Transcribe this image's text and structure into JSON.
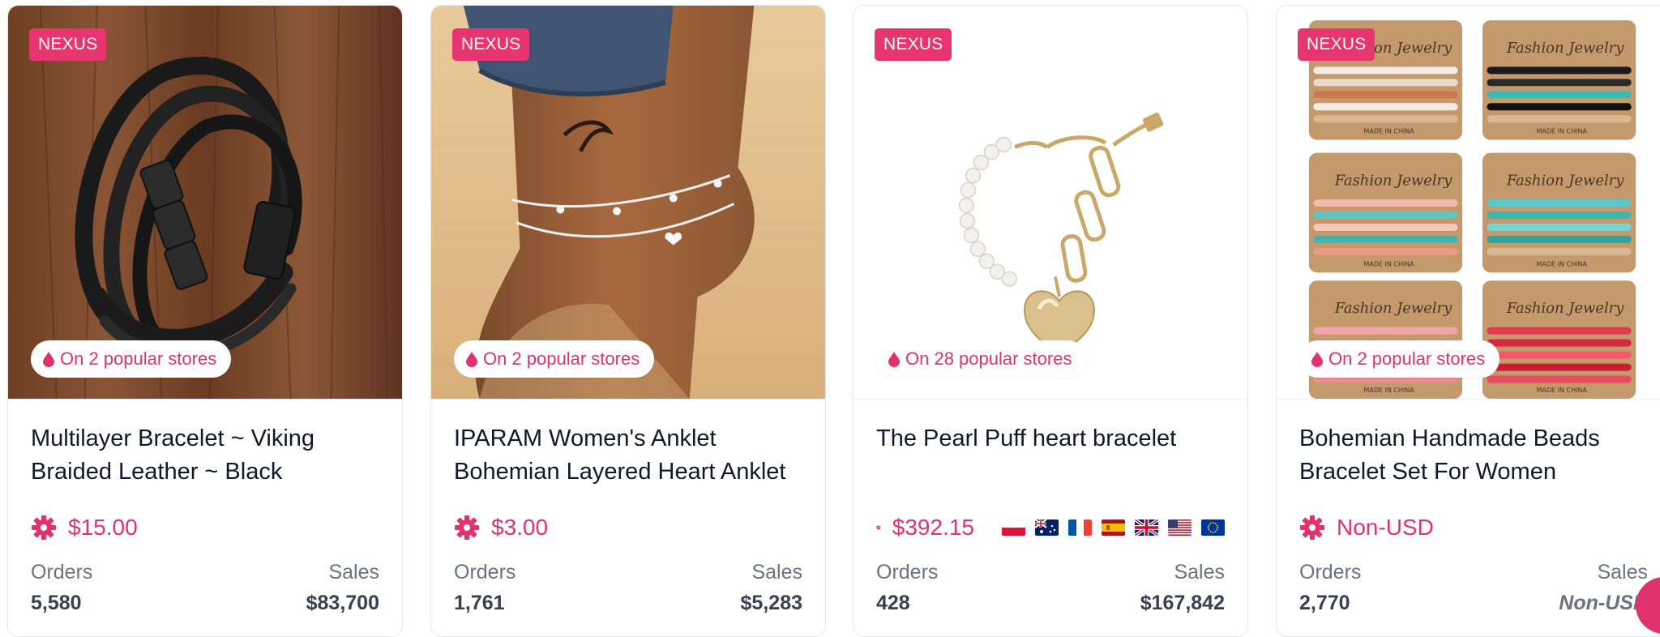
{
  "products": [
    {
      "badge": "NEXUS",
      "popular": "On 2 popular stores",
      "title": "Multilayer Bracelet ~ Viking Braided Leather ~ Black",
      "price": "$15.00",
      "orders_label": "Orders",
      "orders": "5,580",
      "sales_label": "Sales",
      "sales": "$83,700",
      "image_icon": "leather-bracelet-image"
    },
    {
      "badge": "NEXUS",
      "popular": "On 2 popular stores",
      "title": "IPARAM Women's Anklet Bohemian Layered Heart Anklet",
      "price": "$3.00",
      "orders_label": "Orders",
      "orders": "1,761",
      "sales_label": "Sales",
      "sales": "$5,283",
      "image_icon": "anklet-image"
    },
    {
      "badge": "NEXUS",
      "popular": "On 28 popular stores",
      "title": "The Pearl Puff heart bracelet",
      "price": "$392.15",
      "flags": [
        "poland-flag",
        "australia-flag",
        "france-flag",
        "spain-flag",
        "uk-flag",
        "usa-flag",
        "eu-flag"
      ],
      "orders_label": "Orders",
      "orders": "428",
      "sales_label": "Sales",
      "sales": "$167,842",
      "image_icon": "pearl-heart-bracelet-image"
    },
    {
      "badge": "NEXUS",
      "popular": "On 2 popular stores",
      "title": "Bohemian Handmade Beads Bracelet Set For Women",
      "price": "Non-USD",
      "orders_label": "Orders",
      "orders": "2,770",
      "sales_label": "Sales",
      "sales": "Non-USD",
      "image_icon": "beads-bracelet-set-image",
      "card_text": [
        "Fashion Jewelry",
        "MADE IN CHINA"
      ]
    }
  ],
  "colors": {
    "accent": "#e0336d",
    "badge_bg": "#e6356f"
  }
}
